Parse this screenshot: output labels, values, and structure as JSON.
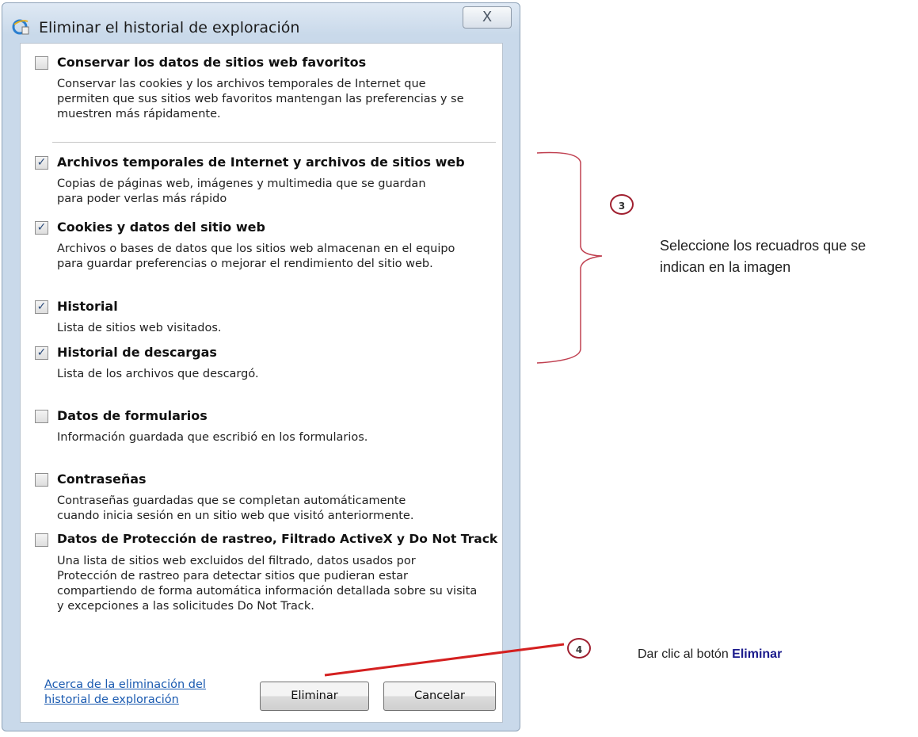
{
  "dialog": {
    "title": "Eliminar el historial de exploración",
    "close_glyph": "X",
    "icon": "internet-explorer-icon",
    "options": [
      {
        "label": "Conservar los datos de sitios web favoritos",
        "checked": false,
        "description": [
          "Conservar las cookies y los archivos temporales de Internet que",
          "permiten que sus sitios web favoritos mantengan las preferencias y se",
          "muestren más rápidamente."
        ]
      },
      {
        "label": "Archivos temporales de Internet y archivos de sitios web",
        "checked": true,
        "description": [
          "Copias de páginas web, imágenes y multimedia que se guardan",
          "para poder verlas más rápido"
        ]
      },
      {
        "label": "Cookies y datos del sitio web",
        "checked": true,
        "description": [
          "Archivos o bases de datos que los sitios web almacenan en el equipo",
          "para guardar preferencias o mejorar el rendimiento del sitio web."
        ]
      },
      {
        "label": "Historial",
        "checked": true,
        "description": [
          "Lista de sitios web visitados."
        ]
      },
      {
        "label": "Historial de descargas",
        "checked": true,
        "description": [
          "Lista de los archivos que descargó."
        ]
      },
      {
        "label": "Datos de formularios",
        "checked": false,
        "description": [
          "Información guardada que escribió en los formularios."
        ]
      },
      {
        "label": "Contraseñas",
        "checked": false,
        "description": [
          "Contraseñas guardadas que se completan automáticamente",
          "cuando inicia sesión en un sitio web que visitó anteriormente."
        ]
      },
      {
        "label": "Datos de Protección de rastreo, Filtrado ActiveX y Do Not Track",
        "checked": false,
        "description": [
          "Una lista de sitios web excluidos del filtrado, datos usados por",
          "Protección de rastreo para detectar sitios que pudieran estar",
          "compartiendo de forma automática información detallada sobre su visita",
          "y excepciones a las solicitudes Do Not Track."
        ]
      }
    ],
    "link_lines": [
      "Acerca de la eliminación del",
      "historial de exploración"
    ],
    "delete_label": "Eliminar",
    "cancel_label": "Cancelar"
  },
  "annotations": {
    "step3_number": "3",
    "step3_text_lines": [
      "Seleccione los recuadros que se",
      "indican en la imagen"
    ],
    "step4_number": "4",
    "step4_text_prefix": "Dar clic al botón ",
    "step4_text_emphasis": "Eliminar",
    "circle_color": "#a02030",
    "bracket_color": "#c04050",
    "arrow_color": "#d42020"
  },
  "colors": {
    "link": "#1a5ab0",
    "emphasis": "#1a1a8c"
  }
}
